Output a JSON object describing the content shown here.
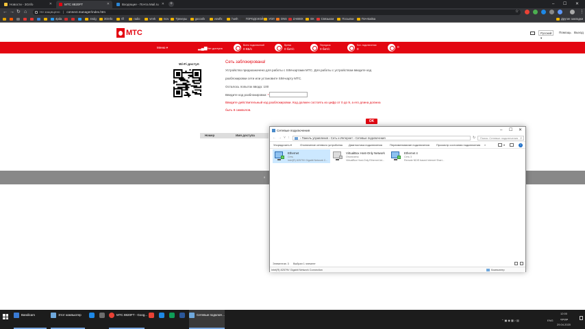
{
  "browser": {
    "tabs": [
      {
        "label": "Новости - 3Gnfo",
        "color": "#f3c33c"
      },
      {
        "label": "МТС 8820FT",
        "color": "#e30611"
      },
      {
        "label": "Входящие - Почта Mail.ru",
        "color": "#2b86d6"
      }
    ],
    "url_warning": "Не защищено",
    "url_sep": "|",
    "url": "connect.manager/index.htm",
    "bookmarks": [
      {
        "label": "",
        "color": "#e0a100"
      },
      {
        "label": "",
        "color": "#ff5a00"
      },
      {
        "label": "",
        "color": "#777"
      },
      {
        "label": "",
        "color": "#e53935"
      },
      {
        "label": "",
        "color": "#e53935"
      },
      {
        "label": "",
        "color": "#3b82d6"
      },
      {
        "label": "",
        "color": "#f0b400"
      },
      {
        "label": "4pda",
        "color": "#2a9df4"
      },
      {
        "label": "",
        "color": "#d32f2f"
      },
      {
        "label": "",
        "color": "#d32f2f"
      },
      {
        "label": "",
        "color": "#2a9df4"
      },
      {
        "label": "4ndg",
        "color": "#f0b400"
      },
      {
        "label": "3GInfo",
        "color": "#f0b400"
      },
      {
        "label": "tfl",
        "color": "#f0b400"
      },
      {
        "label": "radio",
        "color": "#f0b400"
      },
      {
        "label": "vmrk",
        "color": "#f0b400"
      },
      {
        "label": "mov",
        "color": "#f0b400"
      },
      {
        "label": "Трекеры",
        "color": "#f0b400"
      },
      {
        "label": "gocoofx",
        "color": "#f0b400"
      },
      {
        "label": "vowlfx",
        "color": "#f0b400"
      },
      {
        "label": "hush",
        "color": "#f0b400"
      },
      {
        "label": "ГОРОДСКОЙ",
        "color": "#333"
      },
      {
        "label": "УОЛ",
        "color": "#f0b400"
      },
      {
        "label": "DNS",
        "color": "#f47a20"
      },
      {
        "label": "ZABBIX",
        "color": "#d32f2f"
      },
      {
        "label": "ЕК",
        "color": "#f0b400"
      },
      {
        "label": "Связьком",
        "color": "#e53935"
      },
      {
        "label": "Посылки",
        "color": "#f0b400"
      },
      {
        "label": "Поч-Байка",
        "color": "#f0b400"
      }
    ],
    "other_bookmarks": "Другие закладки"
  },
  "header": {
    "logo_text": "МТС",
    "lang": "Русский",
    "help": "Помощь",
    "logout": "Выход"
  },
  "redbar": {
    "menu": "Меню",
    "net_label": "Нет доступа",
    "stats": [
      {
        "label": "Всего подключений",
        "value": "0 КБ/с"
      },
      {
        "label": "Время",
        "value": "0 бит/с"
      },
      {
        "label": "Передача",
        "value": "0 бит/с"
      },
      {
        "label": "Кол. подключения",
        "value": "0"
      },
      {
        "label": "",
        "value": "0"
      }
    ]
  },
  "content": {
    "wifi_title": "Wi-Fi доступ",
    "blocked": "Сеть заблокирована!",
    "line1": "Устройство предназначено для работы с SIM-картами МТС. Для работы с устройством введите код",
    "line2": "разблокировки сети или установите SIM-карту МТС.",
    "attempts": "Осталось попыток ввода: 100",
    "puk_label": "Введите код разблокировки:",
    "puk_star": "*",
    "error": "Введите действительный код разблокировки. Код должен состоять из цифр от 0 до 9, а его длина должна",
    "error2": "быть 8 символов.",
    "ok": "OK",
    "col_num": "Номер",
    "col_name": "Имя доступа",
    "footer": "8"
  },
  "explorer": {
    "title": "Сетевые подключения",
    "path": [
      "Панель управления",
      "Сеть и Интернет",
      "Сетевые подключения"
    ],
    "search": "Поиск: Сетевые подключения",
    "commands": [
      "Упорядочить",
      "Отключение сетевого устройства",
      "Диагностика подключения",
      "Переименование подключения",
      "Просмотр состояния подключения"
    ],
    "adapters": [
      {
        "name": "Ethernet",
        "status": "Сеть",
        "device": "Intel(R) 82579V Gigabit Network C..."
      },
      {
        "name": "VirtualBox Host-Only Network",
        "status": "Отключено",
        "device": "VirtualBox Host-Only Ethernet Ad..."
      },
      {
        "name": "Ethernet 4",
        "status": "Сеть 3",
        "device": "Remote NDIS based Internet Shari..."
      }
    ],
    "items_count": "Элементов: 3",
    "selected": "Выбран 1 элемент",
    "footer_device": "Intel(R) 82579V Gigabit Network Connection",
    "footer_computer": "Компьютер"
  },
  "taskbar": {
    "items": [
      {
        "label": "Bandicam",
        "color": "#3a7bd5"
      },
      {
        "label": "Этот компьютер",
        "color": "#6fa8dc"
      },
      {
        "label": "МТС 8820FT - Goog...",
        "color": "#e94235"
      },
      {
        "label": "Сетевые подключ...",
        "color": "#6fa8dc"
      }
    ],
    "pinned_colors": [
      "#1e88e5",
      "#6d6d6d",
      "#e94235",
      "#1e88e5",
      "#0f9d58",
      "#2b579a",
      "#f4b400"
    ],
    "lang": "ENG",
    "time": "12:00",
    "day": "среда",
    "date": "29.04.2020"
  }
}
